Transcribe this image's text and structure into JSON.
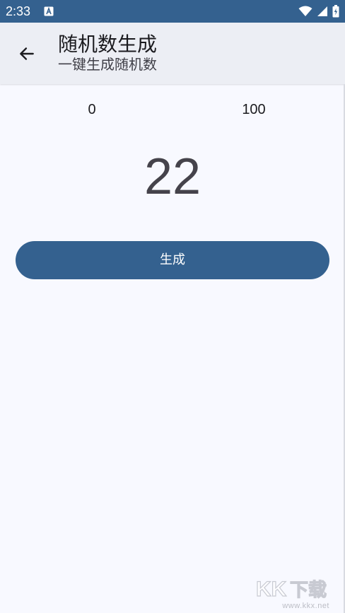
{
  "status_bar": {
    "time": "2:33",
    "background_color": "#34618f",
    "icons": [
      "text-a-icon",
      "wifi-icon",
      "signal-icon",
      "battery-charging-icon"
    ]
  },
  "app_bar": {
    "title": "随机数生成",
    "subtitle": "一键生成随机数",
    "back_icon": "arrow-left-icon"
  },
  "range": {
    "min": "0",
    "max": "100"
  },
  "result": {
    "value": "22"
  },
  "generate_button": {
    "label": "生成",
    "color": "#34618f"
  },
  "watermark": {
    "logo_text": "KK下载",
    "url": "www.kkx.net"
  }
}
